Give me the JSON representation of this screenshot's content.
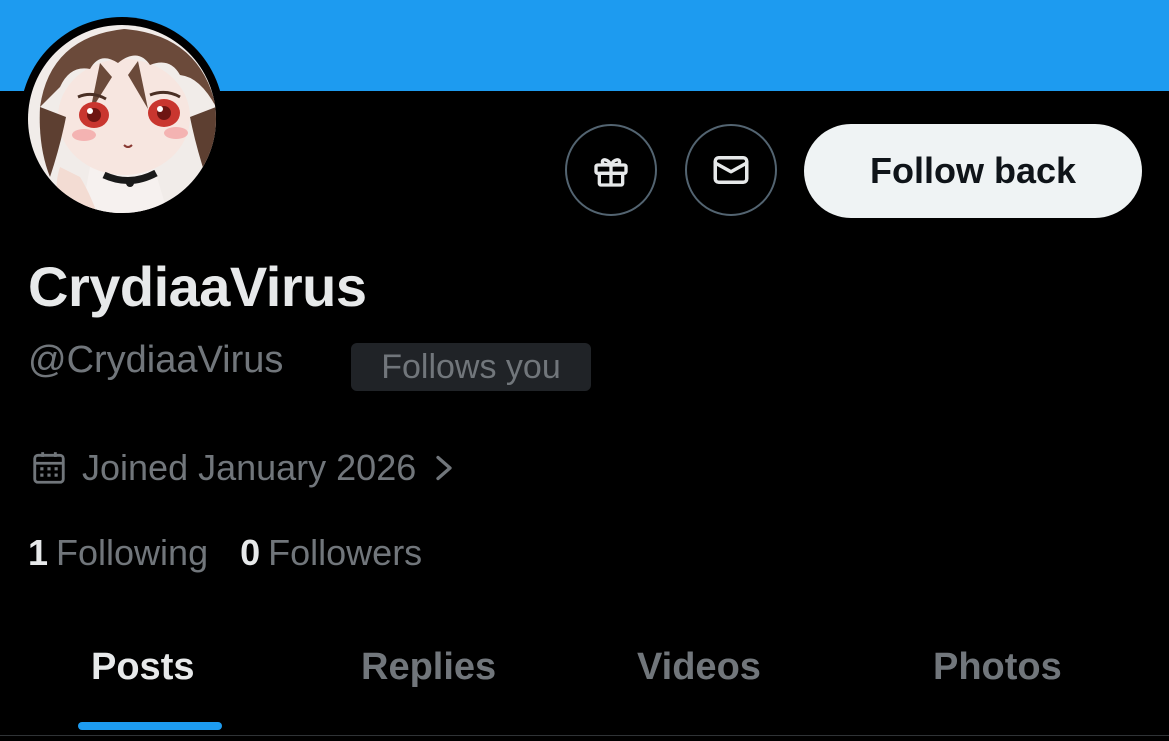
{
  "header": {
    "banner_color": "#1d9bf0"
  },
  "profile": {
    "avatar_icon": "anime-avatar-image",
    "display_name": "CrydiaaVirus",
    "handle": "@CrydiaaVirus",
    "follows_you_badge": "Follows you",
    "joined_text": "Joined January 2026"
  },
  "actions": {
    "gift_icon": "gift-icon",
    "message_icon": "envelope-icon",
    "follow_back_label": "Follow back"
  },
  "stats": {
    "following_count": "1",
    "following_label": "Following",
    "followers_count": "0",
    "followers_label": "Followers"
  },
  "tabs": [
    {
      "label": "Posts",
      "active": true
    },
    {
      "label": "Replies",
      "active": false
    },
    {
      "label": "Videos",
      "active": false
    },
    {
      "label": "Photos",
      "active": false
    }
  ],
  "colors": {
    "background": "#000000",
    "accent": "#1d9bf0",
    "primary_text": "#e7e9ea",
    "secondary_text": "#71767b"
  }
}
